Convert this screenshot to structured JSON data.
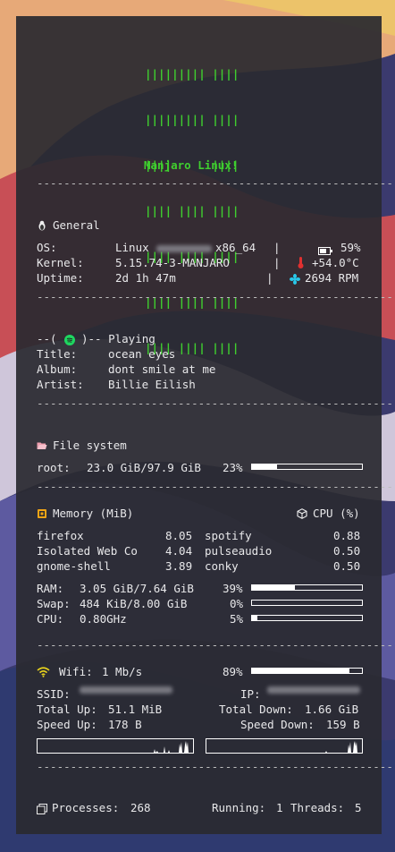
{
  "logo": {
    "lines": [
      "||||||||| ||||",
      "||||||||| ||||",
      "||||      ||||",
      "|||| |||| ||||",
      "|||| |||| ||||",
      "|||| |||| ||||",
      "|||| |||| ||||"
    ],
    "title": "Manjaro Linux!"
  },
  "separator": "-------------------------------------------------------",
  "general": {
    "header": "General",
    "os_label": "OS:",
    "os_value": "Linux",
    "os_arch": "x86_64",
    "kernel_label": "Kernel:",
    "kernel_value": "5.15.74-3-MANJARO",
    "uptime_label": "Uptime:",
    "uptime_value": "2d 1h 47m",
    "battery": "59%",
    "temp": "+54.0°C",
    "fan": "2694 RPM",
    "pipe": "|"
  },
  "playing": {
    "header_prefix": "--(",
    "header_suffix": ")-- Playing",
    "title_label": "Title:",
    "title_value": "ocean eyes",
    "album_label": "Album:",
    "album_value": "dont smile at me",
    "artist_label": "Artist:",
    "artist_value": "Billie Eilish"
  },
  "filesystem": {
    "header": "File system",
    "root_label": "root:",
    "root_value": "23.0 GiB/97.9 GiB",
    "root_percent": "23%",
    "root_fraction": 0.23
  },
  "memory": {
    "header": "Memory (MiB)",
    "procs": [
      {
        "name": "firefox",
        "value": "8.05"
      },
      {
        "name": "Isolated Web Co",
        "value": "4.04"
      },
      {
        "name": "gnome-shell",
        "value": "3.89"
      }
    ]
  },
  "cpu": {
    "header": "CPU (%)",
    "procs": [
      {
        "name": "spotify",
        "value": "0.88"
      },
      {
        "name": "pulseaudio",
        "value": "0.50"
      },
      {
        "name": "conky",
        "value": "0.50"
      }
    ]
  },
  "usage": {
    "ram_label": "RAM:",
    "ram_value": "3.05 GiB/7.64 GiB",
    "ram_percent": "39%",
    "ram_fraction": 0.39,
    "swap_label": "Swap:",
    "swap_value": "484 KiB/8.00 GiB",
    "swap_percent": "0%",
    "swap_fraction": 0.0,
    "cpu_label": "CPU:",
    "cpu_value": "0.80GHz",
    "cpu_percent": "5%",
    "cpu_fraction": 0.05
  },
  "network": {
    "wifi_label": "Wifi:",
    "wifi_speed": "1 Mb/s",
    "wifi_percent": "89%",
    "wifi_fraction": 0.89,
    "ssid_label": "SSID:",
    "ip_label": "IP:",
    "total_up_label": "Total Up:",
    "total_up": "51.1 MiB",
    "total_down_label": "Total Down:",
    "total_down": "1.66 GiB",
    "speed_up_label": "Speed Up:",
    "speed_up": "178 B",
    "speed_down_label": "Speed Down:",
    "speed_down": "159 B"
  },
  "footer": {
    "processes_label": "Processes:",
    "processes": "268",
    "running_label": "Running:",
    "running": "1",
    "threads_label": "Threads:",
    "threads": "5"
  },
  "colors": {
    "logo": "#3fcf2f",
    "spotify": "#1ed760",
    "fan": "#29c7e8",
    "wifi": "#e8d21c",
    "thermo": "#e03030",
    "memory": "#f2a516"
  }
}
